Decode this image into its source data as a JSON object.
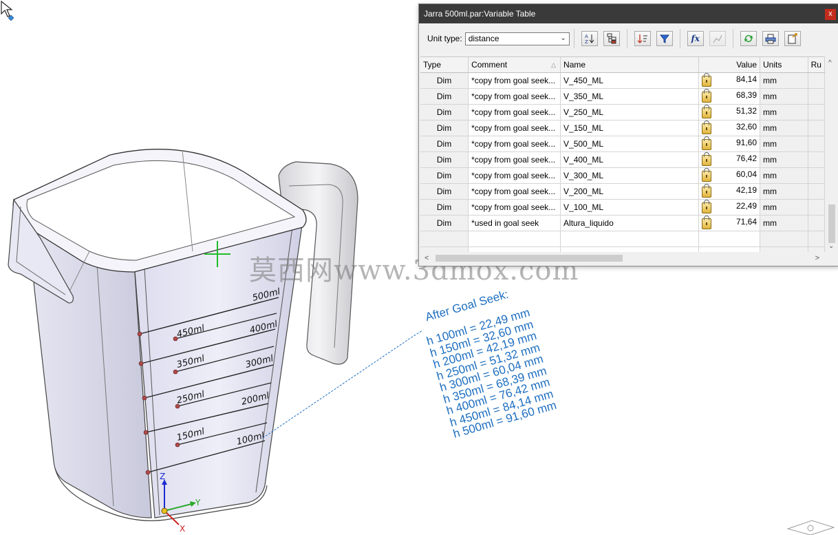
{
  "window": {
    "title": "Jarra 500ml.par:Variable Table",
    "close_label": "x"
  },
  "toolbar": {
    "unit_type_label": "Unit type:",
    "unit_type_value": "distance",
    "buttons": [
      {
        "icon": "sort-az-icon"
      },
      {
        "icon": "tree-view-icon"
      },
      {
        "icon": "sort-order-icon"
      },
      {
        "icon": "filter-icon"
      },
      {
        "icon": "formula-icon",
        "label": "fx"
      },
      {
        "icon": "chart-icon"
      },
      {
        "icon": "refresh-icon"
      },
      {
        "icon": "print-icon"
      },
      {
        "icon": "export-icon"
      }
    ]
  },
  "table": {
    "columns": [
      "Type",
      "Comment",
      "Name",
      "Value",
      "Units",
      "Ru"
    ],
    "rows": [
      {
        "type": "Dim",
        "comment": "*copy from goal seek...",
        "name": "V_450_ML",
        "value": "84,14",
        "units": "mm"
      },
      {
        "type": "Dim",
        "comment": "*copy from goal seek...",
        "name": "V_350_ML",
        "value": "68,39",
        "units": "mm"
      },
      {
        "type": "Dim",
        "comment": "*copy from goal seek...",
        "name": "V_250_ML",
        "value": "51,32",
        "units": "mm"
      },
      {
        "type": "Dim",
        "comment": "*copy from goal seek...",
        "name": "V_150_ML",
        "value": "32,60",
        "units": "mm"
      },
      {
        "type": "Dim",
        "comment": "*copy from goal seek...",
        "name": "V_500_ML",
        "value": "91,60",
        "units": "mm"
      },
      {
        "type": "Dim",
        "comment": "*copy from goal seek...",
        "name": "V_400_ML",
        "value": "76,42",
        "units": "mm"
      },
      {
        "type": "Dim",
        "comment": "*copy from goal seek...",
        "name": "V_300_ML",
        "value": "60,04",
        "units": "mm"
      },
      {
        "type": "Dim",
        "comment": "*copy from goal seek...",
        "name": "V_200_ML",
        "value": "42,19",
        "units": "mm"
      },
      {
        "type": "Dim",
        "comment": "*copy from goal seek...",
        "name": "V_100_ML",
        "value": "22,49",
        "units": "mm"
      },
      {
        "type": "Dim",
        "comment": "*used in goal seek",
        "name": "Altura_liquido",
        "value": "71,64",
        "units": "mm"
      }
    ]
  },
  "viewport": {
    "watermark": "莫西网www.3dmox.com",
    "annotation_title": "After Goal Seek:",
    "annotation_lines": [
      "h 100ml = 22,49 mm",
      "h 150ml = 32,60 mm",
      "h 200ml = 42,19 mm",
      "h 250ml = 51,32 mm",
      "h 300ml = 60,04 mm",
      "h 350ml = 68,39 mm",
      "h 400ml = 76,42 mm",
      "h 450ml = 84,14 mm",
      "h 500ml = 91,60 mm"
    ],
    "scale_labels": {
      "right": [
        "500ml",
        "400ml",
        "300ml",
        "200ml",
        "100ml"
      ],
      "left": [
        "450ml",
        "350ml",
        "250ml",
        "150ml"
      ]
    },
    "axes": {
      "z": "Z",
      "y": "Y",
      "x": "X"
    }
  }
}
